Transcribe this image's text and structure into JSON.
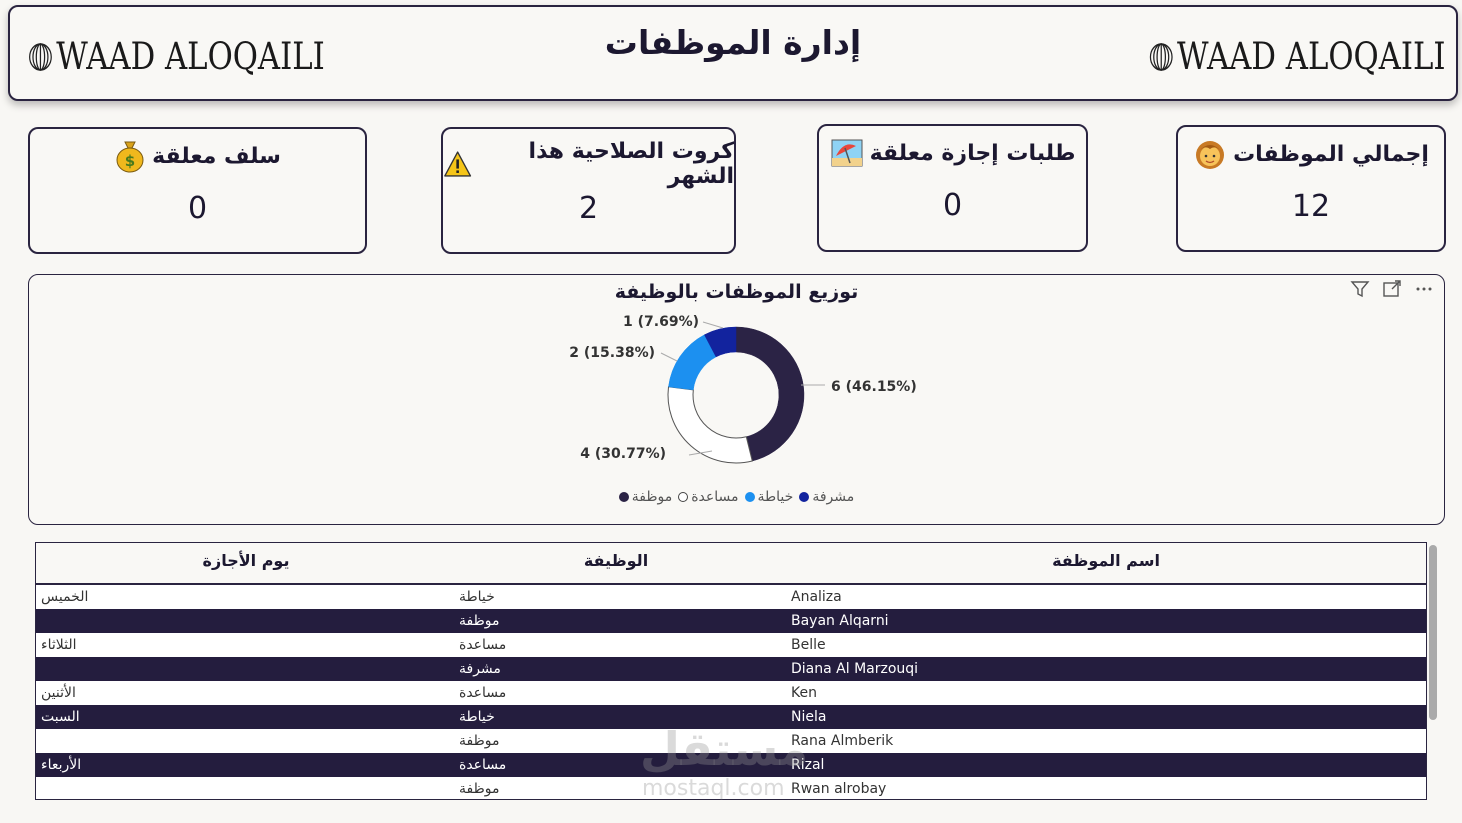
{
  "header": {
    "title": "إدارة الموظفات",
    "logo_text": "WAAD ALOQAILI"
  },
  "cards": [
    {
      "title": "إجمالي الموظفات",
      "icon": "woman-emoji",
      "value": "12"
    },
    {
      "title": "طلبات إجازة معلقة",
      "icon": "beach-emoji",
      "value": "0"
    },
    {
      "title": "كروت الصلاحية هذا الشهر",
      "icon": "warning-emoji",
      "value": "2"
    },
    {
      "title": "سلف معلقة",
      "icon": "money-bag-emoji",
      "value": "0"
    }
  ],
  "chart": {
    "title": "توزيع الموظفات بالوظيفة"
  },
  "chart_data": {
    "type": "pie",
    "title": "توزيع الموظفات بالوظيفة",
    "categories": [
      "موظفة",
      "مساعدة",
      "خياطة",
      "مشرفة"
    ],
    "values": [
      6,
      4,
      2,
      1
    ],
    "labels": [
      "6 (46.15%)",
      "4 (30.77%)",
      "2 (15.38%)",
      "1 (7.69%)"
    ],
    "colors": [
      "#2b2345",
      "#ffffff",
      "#1c90f0",
      "#12239e"
    ],
    "legend_position": "bottom"
  },
  "table": {
    "headers": {
      "name": "اسم الموظفة",
      "job": "الوظيفة",
      "day": "يوم الأجازة"
    },
    "rows": [
      {
        "name": "Analiza",
        "job": "خياطة",
        "day": "الخميس"
      },
      {
        "name": "Bayan Alqarni",
        "job": "موظفة",
        "day": ""
      },
      {
        "name": "Belle",
        "job": "مساعدة",
        "day": "الثلاثاء"
      },
      {
        "name": "Diana Al Marzouqi",
        "job": "مشرفة",
        "day": ""
      },
      {
        "name": "Ken",
        "job": "مساعدة",
        "day": "الأثنين"
      },
      {
        "name": "Niela",
        "job": "خياطة",
        "day": "السبت"
      },
      {
        "name": "Rana Almberik",
        "job": "موظفة",
        "day": ""
      },
      {
        "name": "Rizal",
        "job": "مساعدة",
        "day": "الأربعاء"
      },
      {
        "name": "Rwan alrobay",
        "job": "موظفة",
        "day": ""
      }
    ]
  },
  "watermark": {
    "text": "مستقل",
    "sub": "mostaql.com"
  }
}
